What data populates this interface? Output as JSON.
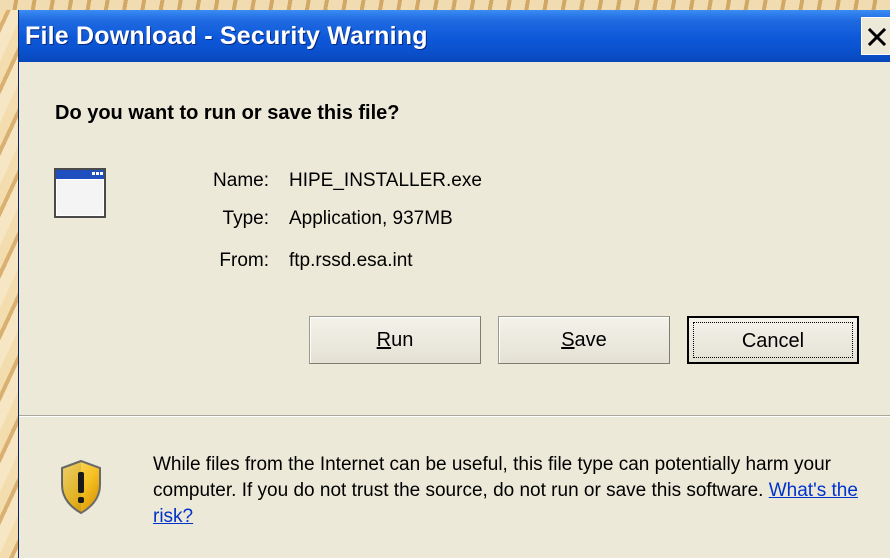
{
  "window": {
    "title": "File Download - Security Warning",
    "close_glyph": "✕"
  },
  "dialog": {
    "question": "Do you want to run or save this file?",
    "file_icon": "application-window-icon",
    "fields": [
      {
        "label": "Name:",
        "value": "HIPE_INSTALLER.exe"
      },
      {
        "label": "Type:",
        "value": "Application, 937MB"
      },
      {
        "label": "From:",
        "value": "ftp.rssd.esa.int"
      }
    ],
    "buttons": {
      "run": {
        "mnemonic": "R",
        "rest": "un"
      },
      "save": {
        "mnemonic": "S",
        "rest": "ave"
      },
      "cancel": {
        "label": "Cancel"
      }
    },
    "warning": {
      "icon": "shield-warning-icon",
      "text": "While files from the Internet can be useful, this file type can potentially harm your computer. If you do not trust the source, do not run or save this software.",
      "link": "What's the risk?"
    }
  },
  "colors": {
    "titlebar": "#0d58d9",
    "dialog_bg": "#ece9d8",
    "link": "#0033cc",
    "shield_yellow": "#f5c021"
  }
}
